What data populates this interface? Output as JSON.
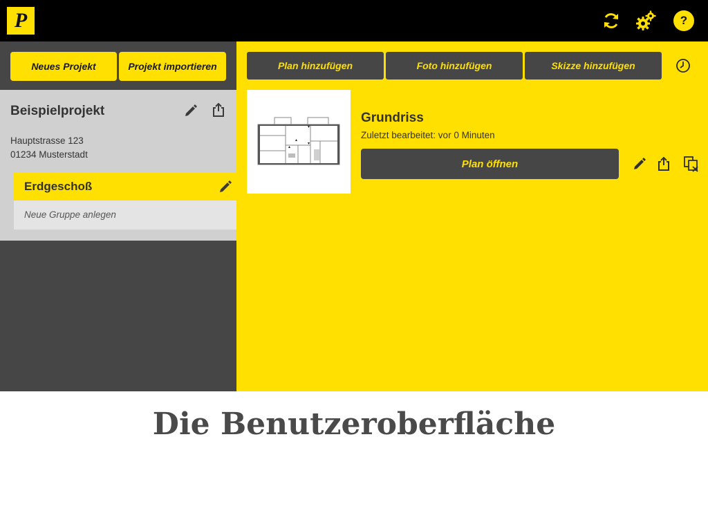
{
  "app": {
    "logo_letter": "P",
    "colors": {
      "accent": "#ffe000",
      "dark": "#464646",
      "topbar": "#000000",
      "panel": "#d0d0d0"
    }
  },
  "topbar": {
    "icons": [
      "sync-icon",
      "settings-gears-icon",
      "help-icon"
    ],
    "help_label": "?"
  },
  "sidebar": {
    "new_project_label": "Neues Projekt",
    "import_project_label": "Projekt importieren",
    "project": {
      "title": "Beispielprojekt",
      "address_line1": "Hauptstrasse 123",
      "address_line2": "01234 Musterstadt"
    },
    "groups": [
      {
        "label": "Erdgeschoß",
        "active": true
      }
    ],
    "new_group_placeholder": "Neue Gruppe anlegen"
  },
  "toolbar": {
    "add_plan_label": "Plan hinzufügen",
    "add_photo_label": "Foto hinzufügen",
    "add_sketch_label": "Skizze hinzufügen"
  },
  "plan": {
    "title": "Grundriss",
    "last_edited": "Zuletzt bearbeitet: vor 0 Minuten",
    "open_label": "Plan öffnen"
  },
  "caption": {
    "text": "Die Benutzeroberfläche"
  }
}
